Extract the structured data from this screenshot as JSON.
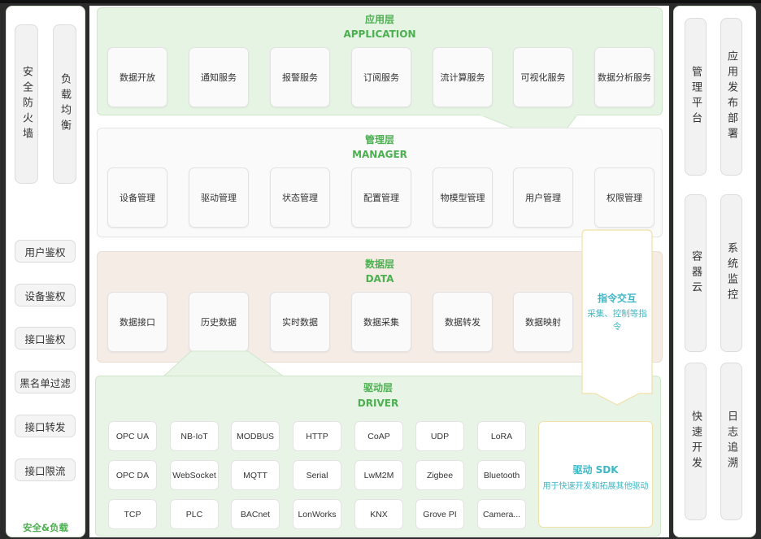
{
  "left": {
    "vpills": [
      "安全防火墙",
      "负载均衡"
    ],
    "items": [
      "用户鉴权",
      "设备鉴权",
      "接口鉴权",
      "黑名单过滤",
      "接口转发",
      "接口限流"
    ],
    "footer": "安全&负载"
  },
  "right": {
    "vpills": [
      "管理平台",
      "应用发布部署",
      "容器云",
      "系统监控",
      "快速开发",
      "日志追溯"
    ]
  },
  "layers": {
    "application": {
      "title_cn": "应用层",
      "title_en": "APPLICATION",
      "cards": [
        "数据开放",
        "通知服务",
        "报警服务",
        "订阅服务",
        "流计算服务",
        "可视化服务",
        "数据分析服务"
      ]
    },
    "manager": {
      "title_cn": "管理层",
      "title_en": "MANAGER",
      "cards": [
        "设备管理",
        "驱动管理",
        "状态管理",
        "配置管理",
        "物模型管理",
        "用户管理",
        "权限管理"
      ]
    },
    "data": {
      "title_cn": "数据层",
      "title_en": "DATA",
      "cards": [
        "数据接口",
        "历史数据",
        "实时数据",
        "数据采集",
        "数据转发",
        "数据映射"
      ]
    },
    "driver": {
      "title_cn": "驱动层",
      "title_en": "DRIVER",
      "protocols": [
        [
          "OPC UA",
          "NB-IoT",
          "MODBUS",
          "HTTP",
          "CoAP",
          "UDP",
          "LoRA"
        ],
        [
          "OPC DA",
          "WebSocket",
          "MQTT",
          "Serial",
          "LwM2M",
          "Zigbee",
          "Bluetooth"
        ],
        [
          "TCP",
          "PLC",
          "BACnet",
          "LonWorks",
          "KNX",
          "Grove PI",
          "Camera..."
        ]
      ]
    }
  },
  "command": {
    "title": "指令交互",
    "subtitle": "采集、控制等指令"
  },
  "sdk": {
    "title": "驱动 SDK",
    "subtitle": "用于快速开发和拓展其他驱动"
  },
  "colors": {
    "green_title": "#4caf50",
    "app_bg": "#e6f4e4",
    "data_bg": "#f6ece6",
    "driver_bg": "#e8f5e6",
    "cyan": "#3fb6c4",
    "cmd_border": "#f1e0a8"
  }
}
